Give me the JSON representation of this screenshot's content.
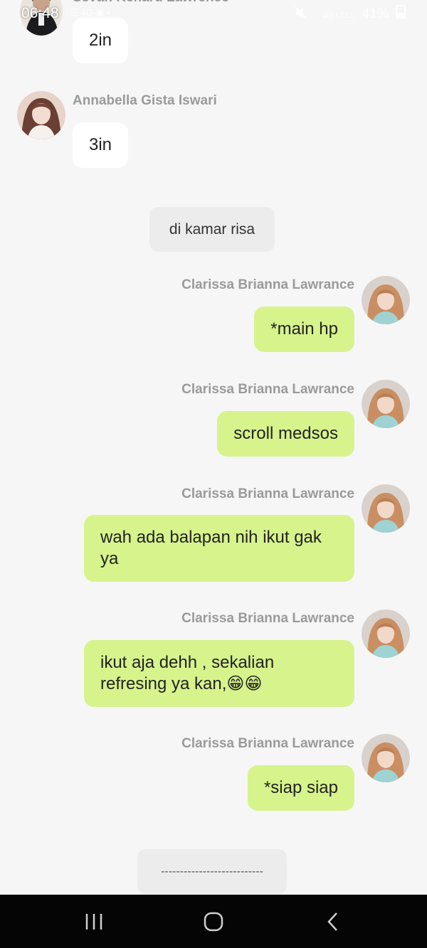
{
  "status_bar": {
    "time": "06:48",
    "left_icons": "☰ 4G ▣ •",
    "signal_label": "Vo) LTE1",
    "battery": "41%"
  },
  "messages": [
    {
      "side": "in",
      "sender": "Sevan Kenaru Lawrence",
      "text": "2in"
    },
    {
      "side": "in",
      "sender": "Annabella Gista Iswari",
      "text": "3in"
    },
    {
      "side": "system",
      "text": "di kamar risa"
    },
    {
      "side": "out",
      "sender": "Clarissa Brianna Lawrance",
      "text": "*main hp"
    },
    {
      "side": "out",
      "sender": "Clarissa Brianna Lawrance",
      "text": "scroll medsos"
    },
    {
      "side": "out",
      "sender": "Clarissa Brianna Lawrance",
      "text_line1": "wah ada balapan nih ikut gak",
      "text_line2": "ya"
    },
    {
      "side": "out",
      "sender": "Clarissa Brianna Lawrance",
      "text_line1": "ikut aja dehh  , sekalian",
      "text_line2": "refresing ya kan,😁😁"
    },
    {
      "side": "out",
      "sender": "Clarissa Brianna Lawrance",
      "text": "*siap siap"
    },
    {
      "side": "system",
      "text": "---------------------------"
    }
  ],
  "icons": {
    "mute": "mute-icon",
    "recent_apps": "recent-apps-icon",
    "home": "home-icon",
    "back": "back-icon"
  },
  "colors": {
    "outgoing_bubble": "#d7f38c",
    "incoming_bubble": "#ffffff",
    "system_bubble": "#ececec",
    "background": "#f6f6f6",
    "sender_name": "#9a9a9a",
    "nav_bar": "#050505"
  }
}
